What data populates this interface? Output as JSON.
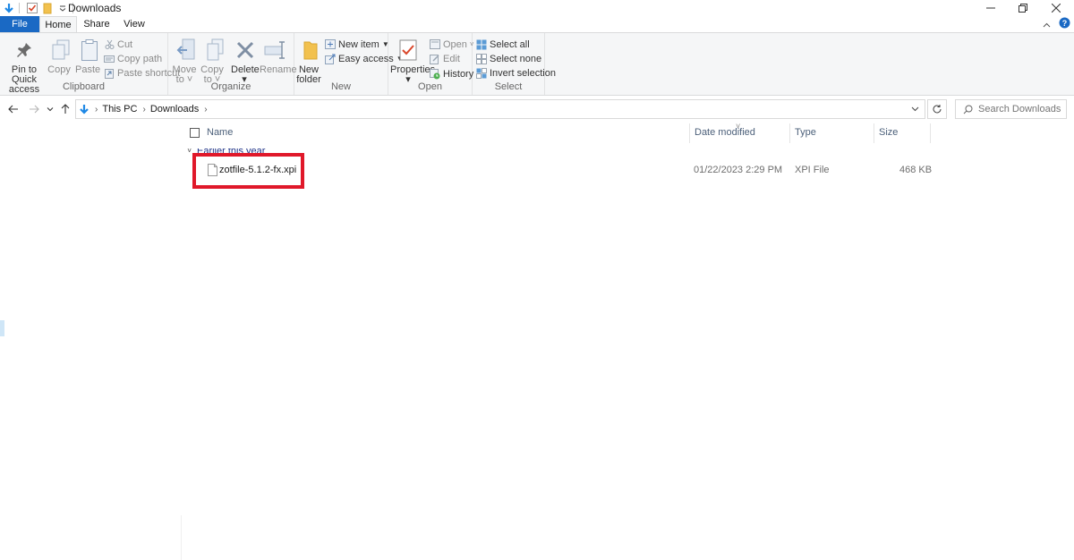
{
  "window": {
    "title": "Downloads"
  },
  "tabs": [
    {
      "label": "File"
    },
    {
      "label": "Home"
    },
    {
      "label": "Share"
    },
    {
      "label": "View"
    }
  ],
  "ribbon": {
    "clipboard": {
      "pin_label_1": "Pin to Quick",
      "pin_label_2": "access",
      "copy": "Copy",
      "paste": "Paste",
      "cut": "Cut",
      "copy_path": "Copy path",
      "paste_shortcut": "Paste shortcut",
      "group": "Clipboard"
    },
    "organize": {
      "move_1": "Move",
      "move_2": "to",
      "copy_1": "Copy",
      "copy_2": "to",
      "delete": "Delete",
      "rename": "Rename",
      "group": "Organize"
    },
    "new": {
      "new_folder_1": "New",
      "new_folder_2": "folder",
      "new_item": "New item",
      "easy_access": "Easy access",
      "group": "New"
    },
    "open": {
      "properties": "Properties",
      "open": "Open",
      "edit": "Edit",
      "history": "History",
      "group": "Open"
    },
    "select": {
      "select_all": "Select all",
      "select_none": "Select none",
      "invert_selection": "Invert selection",
      "group": "Select"
    }
  },
  "address": {
    "crumbs": [
      "This PC",
      "Downloads"
    ],
    "search_placeholder": "Search Downloads"
  },
  "columns": [
    "Name",
    "Date modified",
    "Type",
    "Size"
  ],
  "group_header": "Earlier this year",
  "files": [
    {
      "name": "zotfile-5.1.2-fx.xpi",
      "date": "01/22/2023 2:29 PM",
      "type": "XPI File",
      "size": "468 KB"
    }
  ],
  "colors": {
    "file_tab": "#1a69c4",
    "highlight": "#e0182a",
    "accent_blue": "#1e88e5"
  }
}
